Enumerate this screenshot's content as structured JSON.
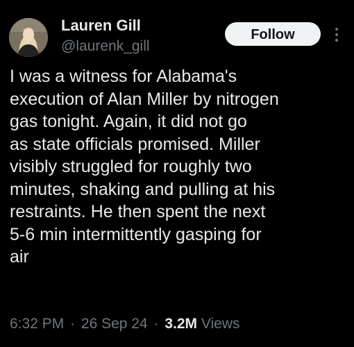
{
  "author": {
    "display_name": "Lauren Gill",
    "handle": "@laurenk_gill"
  },
  "actions": {
    "follow_label": "Follow",
    "more_icon": "more-vertical-icon"
  },
  "tweet": {
    "text": "I was a witness for Alabama's\nexecution of Alan Miller by nitrogen\ngas tonight. Again, it did not go\nas state officials promised. Miller\nvisibly struggled for roughly two\nminutes, shaking and pulling at his\nrestraints. He then spent the next\n5-6 min intermittently gasping for\nair",
    "time": "6:32 PM",
    "separator": "·",
    "date": "26 Sep 24",
    "views_count": "3.2M",
    "views_label": "Views"
  },
  "colors": {
    "background": "#000000",
    "primary_text": "#e7e9ea",
    "secondary_text": "#71767b",
    "follow_button_bg": "#eff3f4",
    "follow_button_text": "#0f1419"
  }
}
